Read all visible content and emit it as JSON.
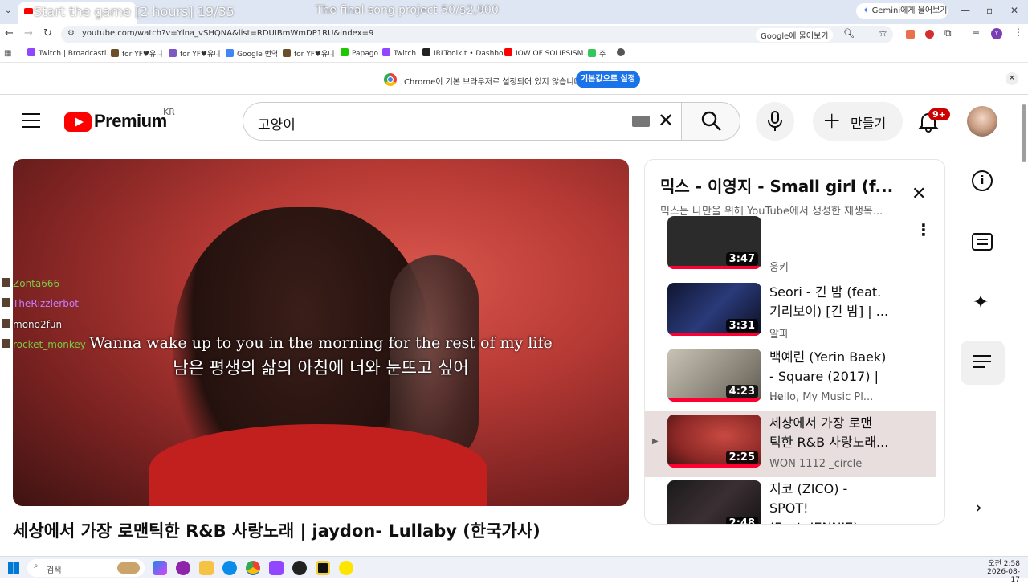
{
  "browser": {
    "tab_overlay_left": "Start the game [2 hours] 19/35",
    "tab_overlay_center": "The final song project 50/$2,900",
    "gemini_button": "Gemini에게 물어보기",
    "url": "youtube.com/watch?v=Ylna_vSHQNA&list=RDUIBmWmDP1RU&index=9",
    "ask_google": "Google에 물어보기",
    "bookmarks": [
      "Twitch | Broadcasti...",
      "for YF♥유니",
      "for YF♥유니",
      "Google 번역",
      "for YF♥유니",
      "Papago",
      "Twitch",
      "IRLToolkit • Dashbo...",
      "IOW OF SOLIPSISM...",
      "주"
    ],
    "infobar_text": "Chrome이 기본 브라우저로 설정되어 있지 않습니다",
    "infobar_button": "기본값으로 설정"
  },
  "youtube": {
    "logo": "Premium",
    "region": "KR",
    "search_value": "고양이",
    "create_label": "만들기",
    "notif_count": "9+"
  },
  "video": {
    "subtitle_en": "Wanna wake up to you in the morning for the rest of my life",
    "subtitle_ko": "남은 평생의 삶의 아침에 너와 눈뜨고 싶어",
    "title": "세상에서 가장 로맨틱한 R&B 사랑노래 | jaydon- Lullaby (한국가사)"
  },
  "chat": [
    {
      "user": "Zonta666",
      "color": "#7ac943"
    },
    {
      "user": "TheRizzlerbot",
      "color": "#c77dff"
    },
    {
      "user": "mono2fun",
      "color": "#dddddd"
    },
    {
      "user": "rocket_monkey",
      "color": "#7ac943"
    }
  ],
  "playlist": {
    "title": "믹스 - 이영지 - Small girl (f...",
    "subtitle": "믹스는 나만을 위해 YouTube에서 생성한 재생목...",
    "partial_item": {
      "duration": "3:47",
      "channel": "웅키"
    },
    "items": [
      {
        "title_line1": "Seori - 긴 밤 (feat.",
        "title_line2": "기리보이) [긴 밤] | ...",
        "channel": "알파",
        "duration": "3:31"
      },
      {
        "title_line1": "백예린 (Yerin Baek)",
        "title_line2": "- Square (2017) | ...",
        "channel": "Hello, My Music Pl...",
        "duration": "4:23"
      },
      {
        "title_line1": "세상에서 가장 로맨",
        "title_line2": "틱한 R&B 사랑노래...",
        "channel": "WON 1112 _circle",
        "duration": "2:25"
      },
      {
        "title_line1": "지코 (ZICO) - SPOT!",
        "title_line2": "(Feat. JENNIE) [가...",
        "channel": "",
        "duration": "2:48"
      }
    ]
  },
  "taskbar": {
    "search_placeholder": "검색",
    "time": "오전 2:58",
    "date": "2026-08-17"
  }
}
